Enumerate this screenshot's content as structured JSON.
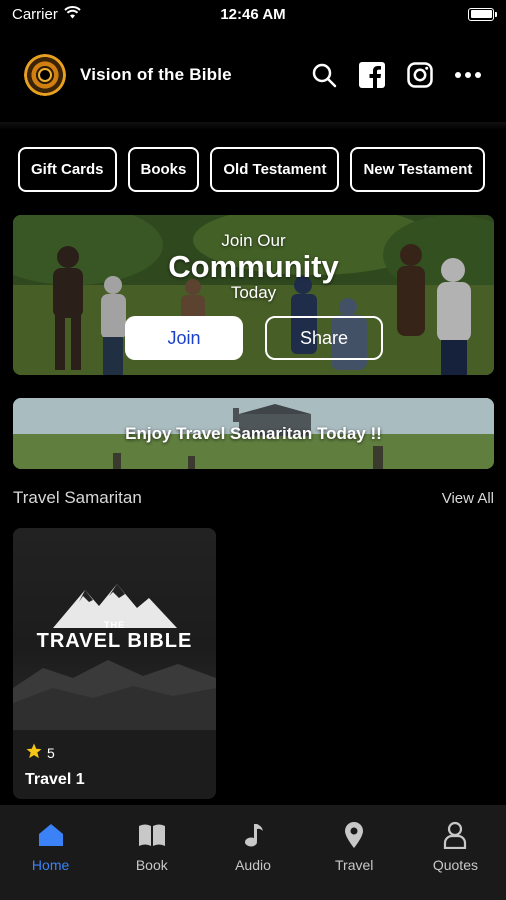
{
  "status_bar": {
    "carrier": "Carrier",
    "time": "12:46 AM"
  },
  "header": {
    "title": "Vision of the Bible"
  },
  "chips": [
    "Gift Cards",
    "Books",
    "Old Testament",
    "New Testament"
  ],
  "community_banner": {
    "line1": "Join Our",
    "line2": "Community",
    "line3": "Today",
    "join_label": "Join",
    "share_label": "Share"
  },
  "travel_banner": {
    "text": "Enjoy Travel Samaritan Today !!"
  },
  "section": {
    "title": "Travel Samaritan",
    "view_all": "View All"
  },
  "card": {
    "image_small": "THE",
    "image_big": "TRAVEL BIBLE",
    "rating": "5",
    "title": "Travel 1"
  },
  "tabs": [
    {
      "label": "Home",
      "icon": "home-icon",
      "active": true
    },
    {
      "label": "Book",
      "icon": "book-icon",
      "active": false
    },
    {
      "label": "Audio",
      "icon": "music-note-icon",
      "active": false
    },
    {
      "label": "Travel",
      "icon": "map-pin-icon",
      "active": false
    },
    {
      "label": "Quotes",
      "icon": "person-icon",
      "active": false
    }
  ],
  "colors": {
    "accent": "#3b82f6",
    "join_text": "#1a3fcc",
    "background": "#000000",
    "tab_bar": "#1a1a1a"
  }
}
